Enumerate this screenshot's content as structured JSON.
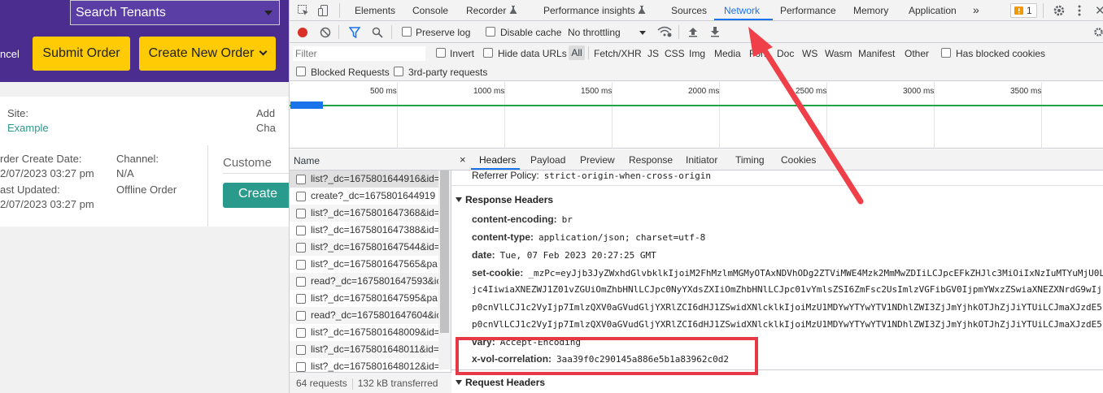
{
  "app": {
    "search_placeholder": "Search Tenants",
    "cancel_label": "ncel",
    "submit_label": "Submit Order",
    "create_new_label": "Create New Order",
    "site_label": "Site:",
    "site_value": "Example",
    "add_label": "Add",
    "cha_label": "Cha",
    "order_create_label": "rder Create Date:",
    "order_create_value": "2/07/2023 03:27 pm",
    "last_updated_label": "ast Updated:",
    "last_updated_value": "2/07/2023 03:27 pm",
    "channel_label": "Channel:",
    "channel_value": "N/A",
    "offline_label": "Offline Order",
    "customer_label": "Custome",
    "create_teal_label": "Create"
  },
  "devtools": {
    "tabs": [
      "Elements",
      "Console",
      "Recorder",
      "Performance insights",
      "Sources",
      "Network",
      "Performance",
      "Memory",
      "Application"
    ],
    "more_tabs": "»",
    "issues_count": "1",
    "toolbar": {
      "preserve_log": "Preserve log",
      "disable_cache": "Disable cache",
      "throttling": "No throttling"
    },
    "filter": {
      "placeholder": "Filter",
      "invert": "Invert",
      "hide_data_urls": "Hide data URLs",
      "types": [
        "All",
        "Fetch/XHR",
        "JS",
        "CSS",
        "Img",
        "Media",
        "Font",
        "Doc",
        "WS",
        "Wasm",
        "Manifest",
        "Other"
      ],
      "has_blocked_cookies": "Has blocked cookies",
      "blocked_requests": "Blocked Requests",
      "third_party": "3rd-party requests"
    },
    "overview_ticks": [
      "500 ms",
      "1000 ms",
      "1500 ms",
      "2000 ms",
      "2500 ms",
      "3000 ms",
      "3500 ms"
    ],
    "request_list": {
      "header": "Name",
      "rows": [
        "list?_dc=1675801644916&id=",
        "create?_dc=1675801644919",
        "list?_dc=1675801647368&id=",
        "list?_dc=1675801647388&id=",
        "list?_dc=1675801647544&id=",
        "list?_dc=1675801647565&pa",
        "read?_dc=1675801647593&ic",
        "list?_dc=1675801647595&pa",
        "read?_dc=1675801647604&ic",
        "list?_dc=1675801648009&id=",
        "list?_dc=1675801648011&id=",
        "list?_dc=1675801648012&id="
      ],
      "requests_count": "64 requests",
      "transferred": "132 kB transferred"
    },
    "details": {
      "close": "×",
      "tabs": [
        "Headers",
        "Payload",
        "Preview",
        "Response",
        "Initiator",
        "Timing",
        "Cookies"
      ],
      "referrer_policy_key": "Referrer Policy:",
      "referrer_policy_value": "strict-origin-when-cross-origin",
      "response_headers_title": "Response Headers",
      "headers": [
        {
          "key": "content-encoding:",
          "value": "br"
        },
        {
          "key": "content-type:",
          "value": "application/json; charset=utf-8"
        },
        {
          "key": "date:",
          "value": "Tue, 07 Feb 2023 20:27:25 GMT"
        }
      ],
      "set_cookie_key": "set-cookie:",
      "set_cookie_lines": [
        "_mzPc=eyJjb3JyZWxhdGlvbklkIjoiM2FhMzlmMGMyOTAxNDVhODg2ZTViMWE4Mzk2MmMwZDIiLCJpcEFkZHJlc3MiOiIxNzIuMTYuMjU0L",
        "jc4IiwiaXNEZWJ1Z01vZGUiOmZhbHNlLCJpc0NyYXdsZXIiOmZhbHNlLCJpc01vYmlsZSI6ZmFsc2UsImlzVGFibGV0IjpmYWxzZSwiaXNEZXNrdG9wIj",
        "p0cnVlLCJ1c2VyIjp7ImlzQXV0aGVudGljYXRlZCI6dHJ1ZSwidXNlcklkIjoiMzU1MDYwYTYwYTV1NDhlZWI3ZjJmYjhkOTJhZjJiYTUiLCJmaXJzdE5",
        "p0cnVlLCJ1c2VyIjp7ImlzQXV0aGVudGljYXRlZCI6dHJ1ZSwidXNlcklkIjoiMzU1MDYwYTYwYTV1NDhlZWI3ZjJmYjhkOTJhZjJiYTUiLCJmaXJzdE5"
      ],
      "vary_key": "vary:",
      "vary_value": "Accept-Encoding",
      "correlation_key": "x-vol-correlation:",
      "correlation_value": "3aa39f0c290145a886e5b1a83962c0d2",
      "request_headers_title": "Request Headers"
    }
  },
  "colors": {
    "annotation_red": "#e53945",
    "app_purple": "#4a2d8f",
    "button_yellow": "#ffcb05",
    "teal": "#2a9a8c",
    "devtools_blue": "#1a73e8"
  }
}
